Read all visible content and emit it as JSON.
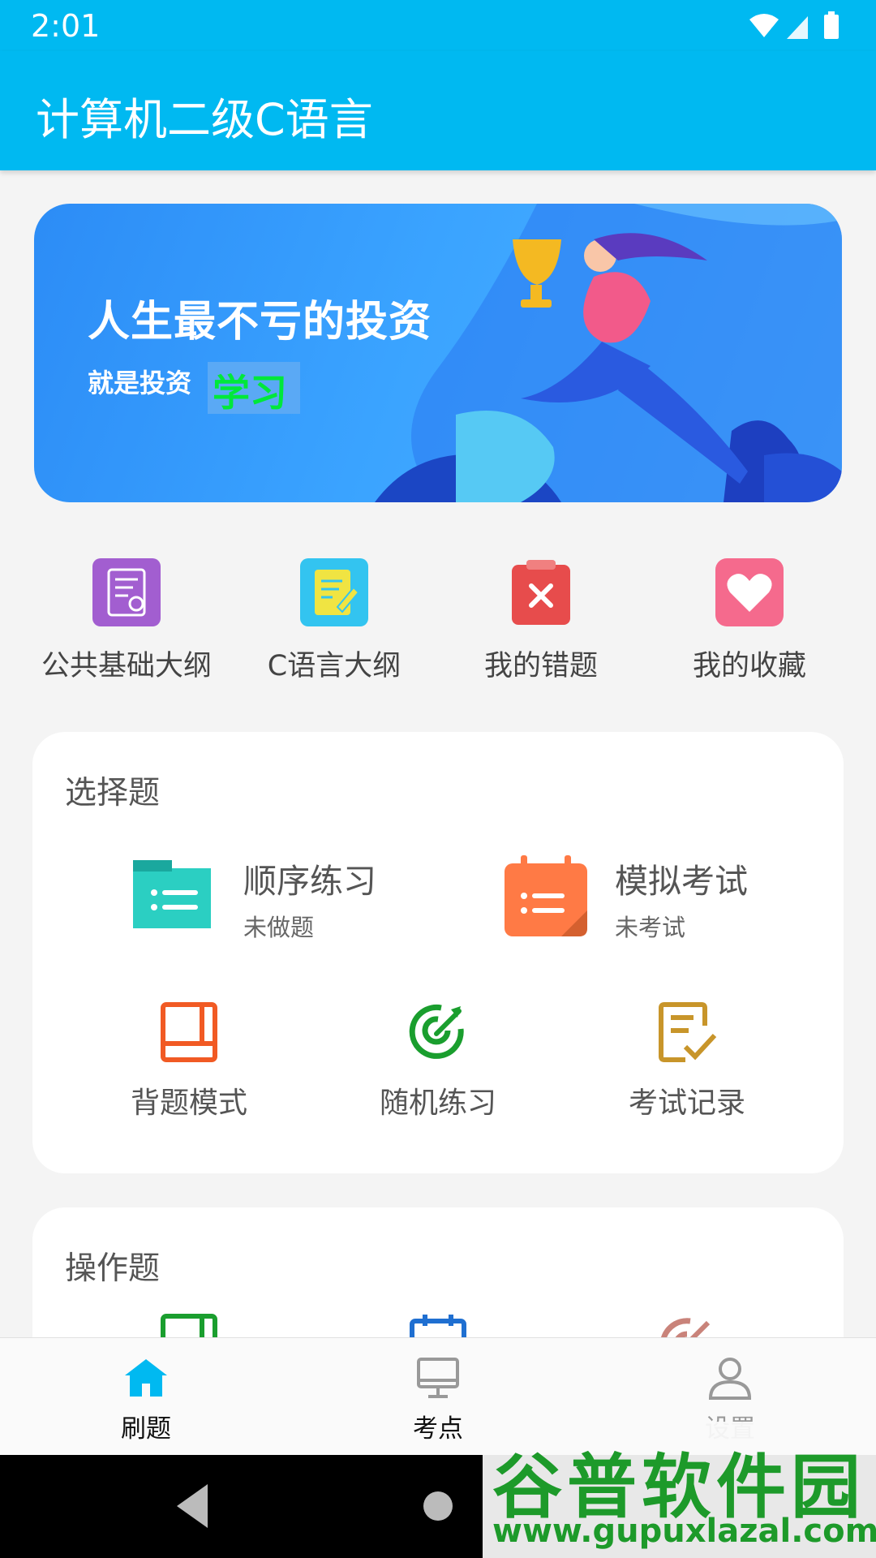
{
  "status_bar": {
    "time": "2:01"
  },
  "app_bar": {
    "title": "计算机二级C语言"
  },
  "banner": {
    "headline": "人生最不亏的投资",
    "subline": "就是投资",
    "highlight": "学习"
  },
  "quick_menu": [
    {
      "label": "公共基础大纲",
      "icon": "outline-search-icon",
      "color": "#a25ed0"
    },
    {
      "label": "C语言大纲",
      "icon": "notepad-edit-icon",
      "color": "#33c4f0"
    },
    {
      "label": "我的错题",
      "icon": "clipboard-x-icon",
      "color": "#e74c4c"
    },
    {
      "label": "我的收藏",
      "icon": "heart-icon",
      "color": "#f56a8d"
    }
  ],
  "choice_section": {
    "title": "选择题",
    "primary": [
      {
        "label": "顺序练习",
        "sub": "未做题",
        "icon": "folder-list-icon"
      },
      {
        "label": "模拟考试",
        "sub": "未考试",
        "icon": "calendar-note-icon"
      }
    ],
    "secondary": [
      {
        "label": "背题模式",
        "icon": "book-icon"
      },
      {
        "label": "随机练习",
        "icon": "target-icon"
      },
      {
        "label": "考试记录",
        "icon": "checklist-icon"
      }
    ]
  },
  "operation_section": {
    "title": "操作题"
  },
  "tabs": [
    {
      "label": "刷题",
      "icon": "home-icon",
      "active": true
    },
    {
      "label": "考点",
      "icon": "monitor-icon",
      "active": false
    },
    {
      "label": "设置",
      "icon": "user-icon",
      "active": false
    }
  ],
  "watermark": {
    "name": "谷普软件园",
    "url": "www.gupuxlazal.com"
  },
  "colors": {
    "primary": "#00b9f1",
    "active_tab": "#00b9f1"
  }
}
